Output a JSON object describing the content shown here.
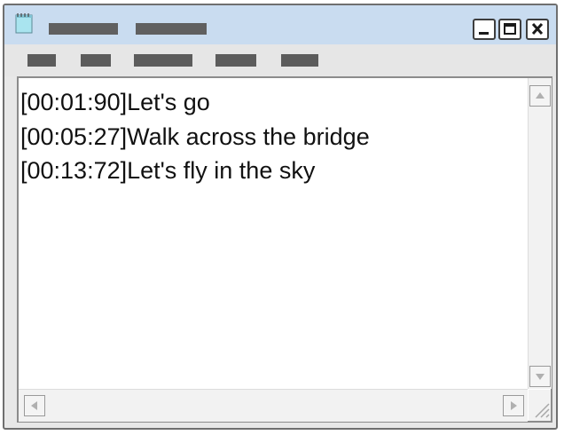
{
  "window": {
    "title_icon": "notepad-icon",
    "controls": {
      "minimize_icon": "minimize-icon",
      "maximize_icon": "maximize-icon",
      "close_icon": "close-icon"
    }
  },
  "editor": {
    "lines": [
      "[00:01:90]Let's go",
      "[00:05:27]Walk across the bridge",
      "[00:13:72]Let's fly in the sky"
    ]
  },
  "scrollbars": {
    "up_icon": "scroll-up-icon",
    "down_icon": "scroll-down-icon",
    "left_icon": "scroll-left-icon",
    "right_icon": "scroll-right-icon",
    "resize_icon": "resize-grip-icon"
  },
  "colors": {
    "titlebar": "#c9dcf0",
    "window_border": "#6f6f6f",
    "text": "#111111",
    "placeholder_blocks": "#606060"
  }
}
